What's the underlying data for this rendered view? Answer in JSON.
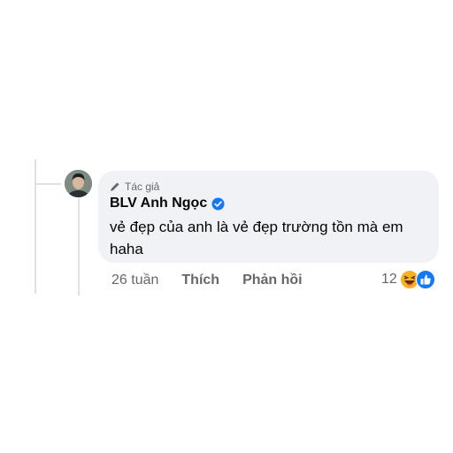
{
  "comment": {
    "author_badge": "Tác giả",
    "author_name": "BLV Anh Ngọc",
    "text": "vẻ đẹp của anh là vẻ đẹp trường tồn mà em haha",
    "time": "26 tuần",
    "like_label": "Thích",
    "reply_label": "Phản hồi",
    "reaction_count": "12",
    "reactions": [
      "haha-icon",
      "like-icon"
    ]
  },
  "colors": {
    "bubble": "#f0f2f5",
    "verified": "#1877f2",
    "meta_text": "#65676b",
    "text": "#050505"
  }
}
